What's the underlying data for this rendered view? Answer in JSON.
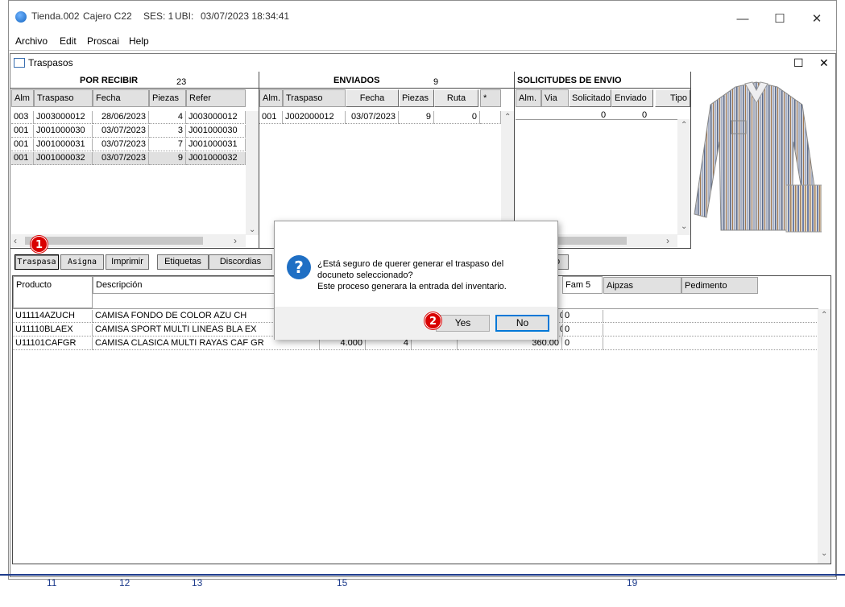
{
  "window": {
    "app": "Tienda.002",
    "cajero": "Cajero C22",
    "ses": "SES: 1",
    "ubi": "UBI:",
    "datetime": "03/07/2023 18:34:41",
    "minimize": "—",
    "maximize": "☐",
    "close": "✕"
  },
  "menu": [
    "Archivo",
    "Edit",
    "Proscai",
    "Help"
  ],
  "child": {
    "title": "Traspasos",
    "maximize": "☐",
    "close": "✕"
  },
  "por_recibir": {
    "title": "POR RECIBIR",
    "count": "23",
    "headers": [
      "Alm",
      "Traspaso",
      "Fecha",
      "Piezas",
      "Refer"
    ],
    "rows": [
      [
        "003",
        "J003000012",
        "28/06/2023",
        "4",
        "J003000012"
      ],
      [
        "001",
        "J001000030",
        "03/07/2023",
        "3",
        "J001000030"
      ],
      [
        "001",
        "J001000031",
        "03/07/2023",
        "7",
        "J001000031"
      ],
      [
        "001",
        "J001000032",
        "03/07/2023",
        "9",
        "J001000032"
      ]
    ]
  },
  "enviados": {
    "title": "ENVIADOS",
    "count": "9",
    "headers": [
      "Alm.",
      "Traspaso",
      "Fecha",
      "Piezas",
      "Ruta",
      "*"
    ],
    "rows": [
      [
        "001",
        "J002000012",
        "03/07/2023",
        "9",
        "0",
        ""
      ]
    ]
  },
  "solicitudes": {
    "title": "SOLICITUDES DE ENVIO",
    "headers": [
      "Alm.",
      "Via",
      "Solicitado",
      "Enviado",
      "Tipo"
    ],
    "totals": [
      "0",
      "0"
    ]
  },
  "toolbar": {
    "traspasa": "Traspasa",
    "asigna": "Asigna",
    "imprimir": "Imprimir",
    "etiquetas": "Etiquetas",
    "discordias": "Discordias",
    "hidden_btn": "o"
  },
  "detail": {
    "headers": [
      "Producto",
      "Descripción",
      "Fam 5",
      "Aipzas",
      "Pedimento"
    ],
    "rows": [
      {
        "producto": "U11114AZUCH",
        "descripcion": "CAMISA FONDO DE COLOR AZU CH",
        "cant": "",
        "pzas": "",
        "precio": "0",
        "fam": "0"
      },
      {
        "producto": "U11110BLAEX",
        "descripcion": "CAMISA SPORT MULTI LINEAS BLA EX",
        "cant": "",
        "pzas": "",
        "precio": "0",
        "fam": "0"
      },
      {
        "producto": "U11101CAFGR",
        "descripcion": "CAMISA CLASICA MULTI RAYAS CAF GR",
        "cant": "4.000",
        "pzas": "4",
        "precio": "360.00",
        "fam": "0"
      }
    ]
  },
  "dialog": {
    "line1": "¿Está seguro de querer generar el traspaso del",
    "line2": "docuneto seleccionado?",
    "line3": "Este proceso generara la entrada del inventario.",
    "yes": "Yes",
    "no": "No",
    "icon": "?"
  },
  "badges": {
    "one": "1",
    "two": "2"
  },
  "footer_numbers": [
    "11",
    "12",
    "13",
    "15",
    "19"
  ],
  "colors": {
    "accent": "#0078d7",
    "badge": "#d90000",
    "dialog_icon": "#1f6fc4"
  }
}
